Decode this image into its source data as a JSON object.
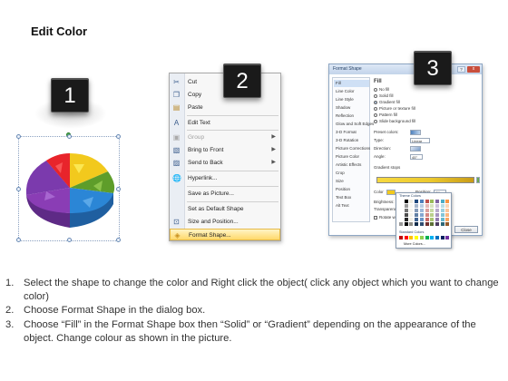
{
  "title": "Edit Color",
  "steps": {
    "one": "1",
    "two": "2",
    "three": "3"
  },
  "context_menu": {
    "items": [
      {
        "icon": "cut-icon",
        "label": "Cut",
        "disabled": false,
        "submenu": false
      },
      {
        "icon": "copy-icon",
        "label": "Copy",
        "disabled": false,
        "submenu": false
      },
      {
        "icon": "paste-icon",
        "label": "Paste",
        "disabled": false,
        "submenu": false
      },
      {
        "icon": "edit-text-icon",
        "label": "Edit Text",
        "disabled": false,
        "submenu": false
      },
      {
        "icon": "group-icon",
        "label": "Group",
        "disabled": true,
        "submenu": true
      },
      {
        "icon": "bring-front-icon",
        "label": "Bring to Front",
        "disabled": false,
        "submenu": true
      },
      {
        "icon": "send-back-icon",
        "label": "Send to Back",
        "disabled": false,
        "submenu": true
      },
      {
        "icon": "hyperlink-icon",
        "label": "Hyperlink...",
        "disabled": false,
        "submenu": false
      },
      {
        "icon": "",
        "label": "Save as Picture...",
        "disabled": false,
        "submenu": false
      },
      {
        "icon": "",
        "label": "Set as Default Shape",
        "disabled": false,
        "submenu": false
      },
      {
        "icon": "size-position-icon",
        "label": "Size and Position...",
        "disabled": false,
        "submenu": false
      },
      {
        "icon": "format-shape-icon",
        "label": "Format Shape...",
        "disabled": false,
        "submenu": false,
        "highlighted": true
      }
    ]
  },
  "dialog": {
    "title": "Format Shape",
    "close_label": "x",
    "help_label": "?",
    "nav": [
      "Fill",
      "Line Color",
      "Line Style",
      "Shadow",
      "Reflection",
      "Glow and Soft Edges",
      "3-D Format",
      "3-D Rotation",
      "Picture Corrections",
      "Picture Color",
      "Artistic Effects",
      "Crop",
      "Size",
      "Position",
      "Text Box",
      "Alt Text"
    ],
    "section_title": "Fill",
    "fill_options": [
      "No fill",
      "Solid fill",
      "Gradient fill",
      "Picture or texture fill",
      "Pattern fill",
      "Slide background fill"
    ],
    "selected_fill": "Gradient fill",
    "labels": {
      "preset": "Preset colors:",
      "type": "Type:",
      "type_value": "Linear",
      "direction": "Direction:",
      "angle": "Angle:",
      "angle_value": "45°",
      "stops": "Gradient stops",
      "color": "Color",
      "position": "Position:",
      "position_value": "0%",
      "brightness": "Brightness:",
      "transparency": "Transparency:",
      "rotate": "Rotate with shape",
      "close_button": "Close"
    },
    "palette": {
      "header": "Theme Colors",
      "standard": "Standard Colors",
      "more": "More Colors...",
      "theme_colors": [
        "#ffffff",
        "#000000",
        "#eeece1",
        "#1f497d",
        "#4f81bd",
        "#c0504d",
        "#9bbb59",
        "#8064a2",
        "#4bacc6",
        "#f79646"
      ],
      "standard_colors": [
        "#c00000",
        "#ff0000",
        "#ffc000",
        "#ffff00",
        "#92d050",
        "#00b050",
        "#00b0f0",
        "#0070c0",
        "#002060",
        "#7030a0"
      ]
    }
  },
  "pie_colors": [
    "#f7d023",
    "#e8242b",
    "#6aaa2f",
    "#2b86d6",
    "#8a3db5"
  ],
  "instructions": [
    {
      "num": "1.",
      "text": "Select the shape to change the color and Right click the object( click any object which you want to change color)"
    },
    {
      "num": "2.",
      "text": "Choose Format Shape in the dialog box."
    },
    {
      "num": "3.",
      "text": "Choose “Fill” in the Format Shape box then “Solid” or “Gradient” depending on the appearance of the object. Change colour as shown in the picture."
    }
  ]
}
